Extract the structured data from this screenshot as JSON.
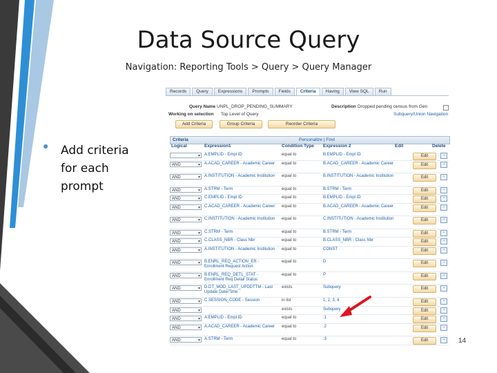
{
  "slide": {
    "title": "Data Source Query",
    "subtitle": "Navigation: Reporting Tools > Query > Query Manager",
    "bullet_text": "Add criteria for each prompt",
    "page_number": "14",
    "accent_color": "#2e8fd6",
    "arrow_color": "#e0141e"
  },
  "screenshot": {
    "tabs": [
      "Records",
      "Query",
      "Expressions",
      "Prompts",
      "Fields",
      "Criteria",
      "Having",
      "View SQL",
      "Run"
    ],
    "active_tab": "Criteria",
    "query_name_label": "Query Name",
    "query_name_value": "UNPL_DROP_PENDING_SUMMARY",
    "description_label": "Description",
    "description_value": "Dropped pending census from Gen",
    "working_selection_label": "Working on selection",
    "working_selection_value": "Top Level of Query",
    "subquery_label": "Subquery/Union Navigation",
    "buttons": {
      "add_criteria": "Add Criteria",
      "group_criteria": "Group Criteria",
      "reorder_criteria": "Reorder Criteria"
    },
    "criteria_title": "Criteria",
    "criteria_nav": "Personalize | Find",
    "columns": {
      "logical": "Logical",
      "expression1": "Expression1",
      "condition_type": "Condition Type",
      "expression2": "Expression 2",
      "edit": "Edit",
      "delete": "Delete"
    },
    "edit_label": "Edit",
    "rows": [
      {
        "logical": "",
        "expr1": "A.EMPLID - Empl ID",
        "cond": "equal to",
        "expr2": "B.EMPLID - Empl ID",
        "tall": false
      },
      {
        "logical": "AND",
        "expr1": "A.ACAD_CAREER - Academic Career",
        "cond": "equal to",
        "expr2": "B.ACAD_CAREER - Academic Career",
        "tall": true
      },
      {
        "logical": "AND",
        "expr1": "A.INSTITUTION - Academic Institution",
        "cond": "equal to",
        "expr2": "B.INSTITUTION - Academic Institution",
        "tall": true
      },
      {
        "logical": "AND",
        "expr1": "A.STRM - Term",
        "cond": "equal to",
        "expr2": "B.STRM - Term",
        "tall": false
      },
      {
        "logical": "AND",
        "expr1": "C.EMPLID - Empl ID",
        "cond": "equal to",
        "expr2": "B.EMPLID - Empl ID",
        "tall": false
      },
      {
        "logical": "AND",
        "expr1": "C.ACAD_CAREER - Academic Career",
        "cond": "equal to",
        "expr2": "B.ACAD_CAREER - Academic Career",
        "tall": true
      },
      {
        "logical": "AND",
        "expr1": "C.INSTITUTION - Academic Institution",
        "cond": "equal to",
        "expr2": "C.INSTITUTION - Academic Institution",
        "tall": true
      },
      {
        "logical": "AND",
        "expr1": "C.STRM - Term",
        "cond": "equal to",
        "expr2": "B.STRM - Term",
        "tall": false
      },
      {
        "logical": "AND",
        "expr1": "C.CLASS_NBR - Class Nbr",
        "cond": "equal to",
        "expr2": "B.CLASS_NBR - Class Nbr",
        "tall": false
      },
      {
        "logical": "AND",
        "expr1": "A.INSTITUTION - Academic Institution",
        "cond": "equal to",
        "expr2": "CONST",
        "tall": true
      },
      {
        "logical": "AND",
        "expr1": "B.ENRL_REQ_ACTION_ER - Enrollment Request Action",
        "cond": "equal to",
        "expr2": "D",
        "tall": true
      },
      {
        "logical": "AND",
        "expr1": "B.ENRL_REQ_DETL_STAT - Enrollment Req Detail Status",
        "cond": "equal to",
        "expr2": "P",
        "tall": true
      },
      {
        "logical": "AND",
        "expr1": "D.DT_MOD_LAST_UPDDTTM - Last Update Date/Time",
        "cond": "exists",
        "expr2": "Subquery",
        "tall": true
      },
      {
        "logical": "AND",
        "expr1": "C.SESSION_CODE - Session",
        "cond": "in list",
        "expr2": "1, 2, 3, 4",
        "tall": false
      },
      {
        "logical": "AND",
        "expr1": "",
        "cond": "exists",
        "expr2": "Subquery",
        "tall": false
      },
      {
        "logical": "AND",
        "expr1": "A.EMPLID - Empl ID",
        "cond": "equal to",
        "expr2": ":1",
        "tall": false
      },
      {
        "logical": "AND",
        "expr1": "A.ACAD_CAREER - Academic Career",
        "cond": "equal to",
        "expr2": ":2",
        "tall": true
      },
      {
        "logical": "AND",
        "expr1": "A.STRM - Term",
        "cond": "equal to",
        "expr2": ":3",
        "tall": false
      }
    ]
  }
}
